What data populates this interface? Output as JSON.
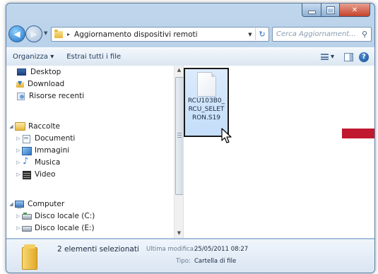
{
  "window": {
    "address_path": "Aggiornamento dispositivi remoti",
    "search_placeholder": "Cerca Aggiornament..."
  },
  "toolbar": {
    "organize_label": "Organizza ▾",
    "extract_label": "Estrai tutti i file",
    "views_dropdown": "▾"
  },
  "sidebar": {
    "items": [
      {
        "label": "Desktop",
        "icon": "desktop-icon"
      },
      {
        "label": "Download",
        "icon": "download-folder-icon"
      },
      {
        "label": "Risorse recenti",
        "icon": "recent-places-icon"
      },
      {
        "label": "Raccolte",
        "icon": "libraries-icon"
      },
      {
        "label": "Documenti",
        "icon": "documents-icon"
      },
      {
        "label": "Immagini",
        "icon": "pictures-icon"
      },
      {
        "label": "Musica",
        "icon": "music-icon"
      },
      {
        "label": "Video",
        "icon": "video-icon"
      },
      {
        "label": "Computer",
        "icon": "computer-icon"
      },
      {
        "label": "Disco locale (C:)",
        "icon": "drive-icon"
      },
      {
        "label": "Disco locale (E:)",
        "icon": "drive-icon"
      }
    ]
  },
  "content": {
    "file_name": "RCU103B0_RCU_SELETRON.S19",
    "file_icon": "file-icon",
    "accent_color": "#c0182e"
  },
  "details": {
    "selection_count": "2 elementi selezionati",
    "modified_label": "Ultima modifica:",
    "modified_value": "25/05/2011 08:27",
    "type_label": "Tipo:",
    "type_value": "Cartella di file"
  }
}
